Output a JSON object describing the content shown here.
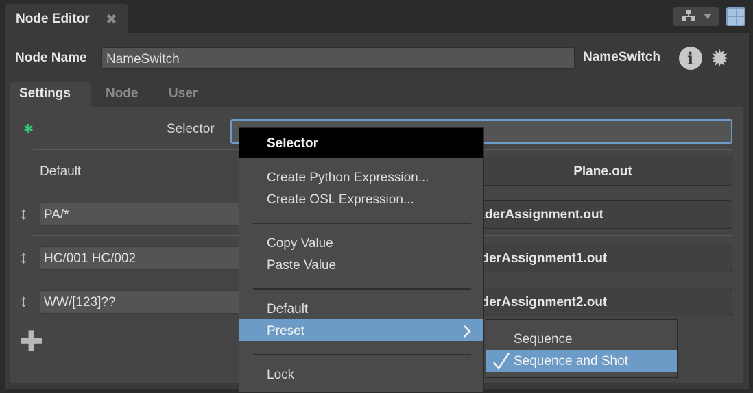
{
  "window": {
    "tab_title": "Node Editor",
    "tab_close_glyph": "✖"
  },
  "header": {
    "node_name_label": "Node Name",
    "node_name_value": "NameSwitch",
    "node_type": "NameSwitch",
    "info_glyph": "i",
    "gear_glyph": "✹"
  },
  "subtabs": [
    {
      "label": "Settings",
      "active": true
    },
    {
      "label": "Node",
      "active": false
    },
    {
      "label": "User",
      "active": false
    }
  ],
  "settings": {
    "selector_label": "Selector",
    "default_label": "Default",
    "default_value": "Plane.out",
    "rows": [
      {
        "key": "PA/*",
        "value": "ShaderAssignment.out"
      },
      {
        "key": "HC/001 HC/002",
        "value": "ShaderAssignment1.out"
      },
      {
        "key": "WW/[123]??",
        "value": "ShaderAssignment2.out"
      }
    ],
    "drag_glyph": "↕",
    "add_glyph": "✚",
    "modified_glyph": "✱"
  },
  "context_menu": {
    "title": "Selector",
    "items": [
      {
        "label": "Create Python Expression..."
      },
      {
        "label": "Create OSL Expression..."
      },
      {
        "label": "Copy Value"
      },
      {
        "label": "Paste Value"
      },
      {
        "label": "Default"
      },
      {
        "label": "Preset",
        "highlighted": true,
        "submenu_glyph": "›"
      },
      {
        "label": "Lock"
      }
    ]
  },
  "preset_submenu": {
    "items": [
      {
        "label": "Sequence",
        "checked": false
      },
      {
        "label": "Sequence and Shot",
        "checked": true
      }
    ],
    "check_glyph": "✓"
  },
  "colors": {
    "accent": "#6d9bc7",
    "modified": "#2ecc71"
  }
}
